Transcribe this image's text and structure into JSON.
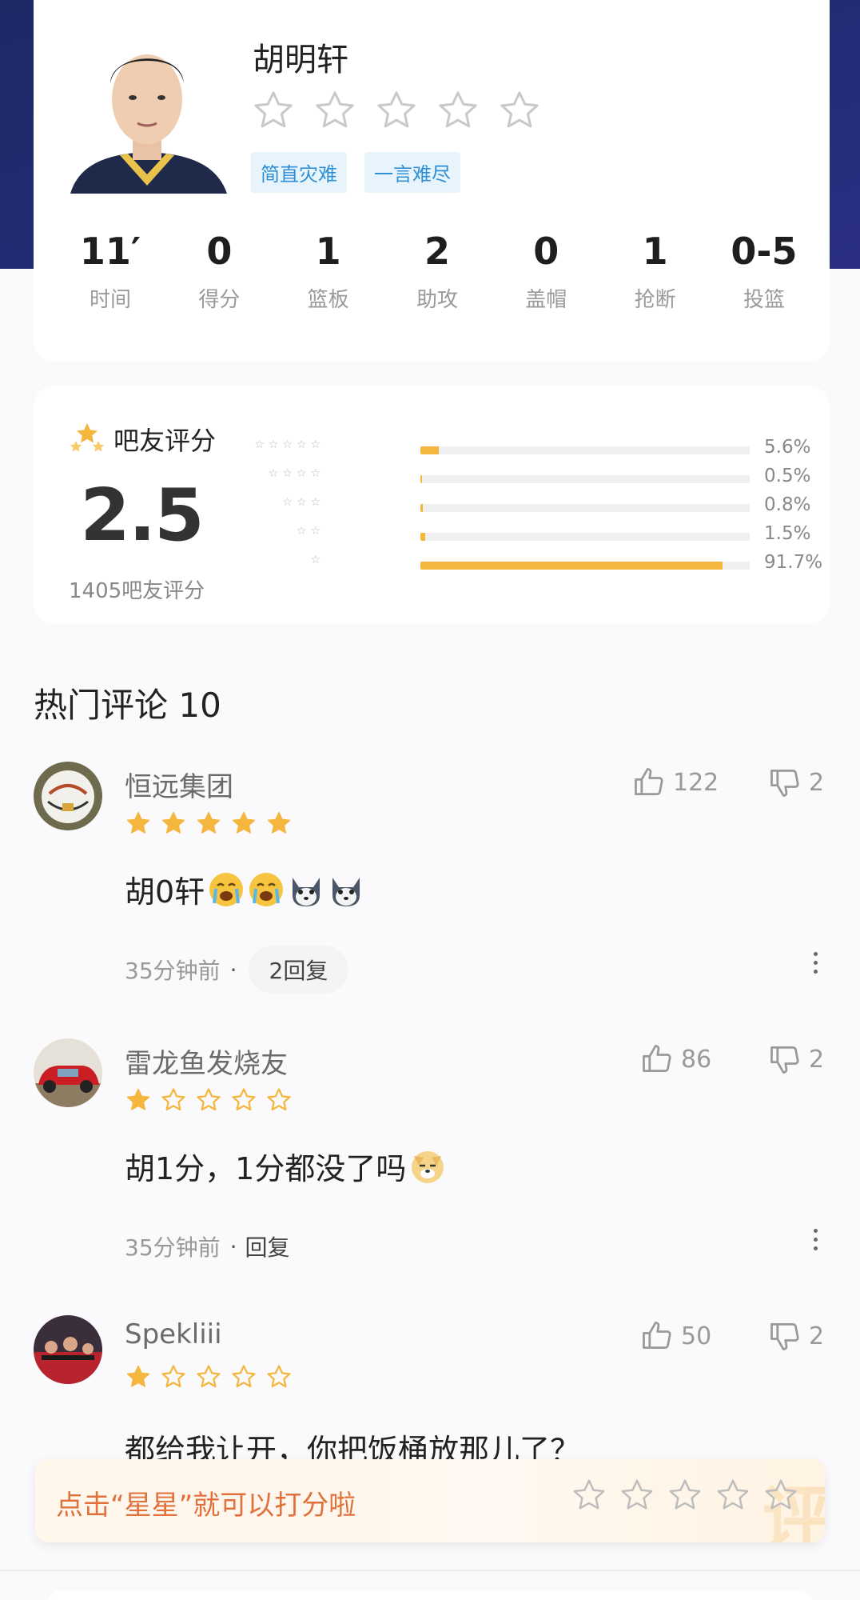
{
  "player": {
    "name": "胡明轩",
    "tags": [
      "简直灾难",
      "一言难尽"
    ],
    "stats": [
      {
        "value": "11′",
        "label": "时间"
      },
      {
        "value": "0",
        "label": "得分"
      },
      {
        "value": "1",
        "label": "篮板"
      },
      {
        "value": "2",
        "label": "助攻"
      },
      {
        "value": "0",
        "label": "盖帽"
      },
      {
        "value": "1",
        "label": "抢断"
      },
      {
        "value": "0-5",
        "label": "投篮"
      }
    ]
  },
  "rating": {
    "title": "吧友评分",
    "score": "2.5",
    "count_text": "1405吧友评分",
    "distribution": [
      {
        "stars": 5,
        "percent": 5.6,
        "label": "5.6%"
      },
      {
        "stars": 4,
        "percent": 0.5,
        "label": "0.5%"
      },
      {
        "stars": 3,
        "percent": 0.8,
        "label": "0.8%"
      },
      {
        "stars": 2,
        "percent": 1.5,
        "label": "1.5%"
      },
      {
        "stars": 1,
        "percent": 91.7,
        "label": "91.7%"
      }
    ]
  },
  "comments_header": "热门评论 10",
  "comments": [
    {
      "user": "恒远集团",
      "stars": 5,
      "text": "胡0轩",
      "emojis": [
        "crying",
        "crying",
        "husky",
        "husky"
      ],
      "time": "35分钟前",
      "reply": "2回复",
      "likes": "122",
      "dislikes": "2"
    },
    {
      "user": "雷龙鱼发烧友",
      "stars": 1,
      "text": "胡1分，1分都没了吗",
      "emojis": [
        "doge"
      ],
      "time": "35分钟前",
      "reply": "回复",
      "likes": "86",
      "dislikes": "2"
    },
    {
      "user": "Spekliii",
      "stars": 1,
      "text": "都给我让开，你把饭桶放那儿了？",
      "emojis": [],
      "time": "",
      "reply": "",
      "likes": "50",
      "dislikes": "2"
    }
  ],
  "prompt": {
    "text": "点击“星星”就可以打分啦",
    "deco": "评"
  },
  "colors": {
    "header_band": "#1d2a66",
    "star_gold": "#f5b63e",
    "tag_blue": "#2f8fd6",
    "prompt_orange": "#e0713a"
  }
}
